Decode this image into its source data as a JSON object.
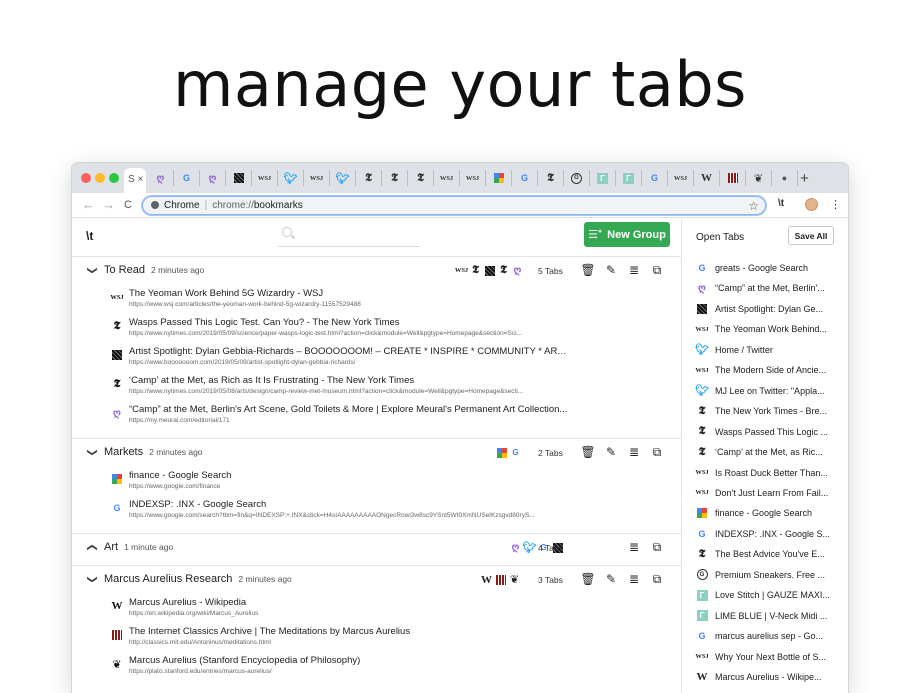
{
  "hero": {
    "title": "manage your tabs"
  },
  "browser": {
    "active_tab_label": "S ×",
    "tab_favicons": [
      "meural",
      "google",
      "meural",
      "booooooom",
      "wsj",
      "twitter",
      "wsj",
      "twitter",
      "nyt",
      "nyt",
      "nyt",
      "wsj",
      "wsj",
      "finance",
      "google",
      "nyt",
      "gauze",
      "stitch",
      "stitch",
      "google",
      "wsj",
      "wikipedia",
      "classics",
      "stanford",
      "apple"
    ],
    "new_tab": "+",
    "omnibar": {
      "back": "←",
      "forward": "→",
      "reload": "C",
      "site_label": "Chrome",
      "url_prefix": "chrome://",
      "url_path": "bookmarks",
      "star": "☆",
      "ext_label": "\\t",
      "menu": "⋮"
    }
  },
  "app": {
    "logo": "\\t",
    "search_placeholder": "",
    "new_group_label": "New Group",
    "groups": [
      {
        "name": "To Read",
        "time": "2 minutes ago",
        "expanded": true,
        "tab_count": "5 Tabs",
        "favicons": [
          "wsj",
          "nyt",
          "booooooom",
          "nyt",
          "meural"
        ],
        "items": [
          {
            "icon": "wsj",
            "title": "The Yeoman Work Behind 5G Wizardry - WSJ",
            "url": "https://www.wsj.com/articles/the-yeoman-work-behind-5g-wizardry-11557529488"
          },
          {
            "icon": "nyt",
            "title": "Wasps Passed This Logic Test. Can You? - The New York Times",
            "url": "https://www.nytimes.com/2019/05/09/science/paper-wasps-logic-test.html?action=click&module=Well&pgtype=Homepage&section=Sci..."
          },
          {
            "icon": "booooooom",
            "title": "Artist Spotlight: Dylan Gebbia-Richards – BOOOOOOOM! – CREATE * INSPIRE * COMMUNITY * ART * ...",
            "url": "https://www.booooooom.com/2019/05/09/artist-spotlight-dylan-gebbia-richards/"
          },
          {
            "icon": "nyt",
            "title": "‘Camp’ at the Met, as Rich as It Is Frustrating - The New York Times",
            "url": "https://www.nytimes.com/2019/05/08/arts/design/camp-review-met-museum.html?action=click&module=Well&pgtype=Homepage&secti..."
          },
          {
            "icon": "meural",
            "title": "“Camp” at the Met, Berlin's Art Scene, Gold Toilets & More | Explore Meural's Permanent Art Collection...",
            "url": "https://my.meural.com/editorial/171"
          }
        ]
      },
      {
        "name": "Markets",
        "time": "2 minutes ago",
        "expanded": true,
        "tab_count": "2 Tabs",
        "favicons": [
          "finance",
          "google"
        ],
        "items": [
          {
            "icon": "finance",
            "title": "finance - Google Search",
            "url": "https://www.google.com/finance"
          },
          {
            "icon": "google",
            "title": "INDEXSP: .INX - Google Search",
            "url": "https://www.google.com/search?tbm=fin&q=INDEXSP:+.INX&stick=H4sIAAAAAAAAAONgecRowi3w8sc9YSnt5Wt0XmNUSeIKzsgvd80ryS..."
          }
        ]
      },
      {
        "name": "Art",
        "time": "1 minute ago",
        "expanded": false,
        "tab_count": "4 Tabs",
        "favicons": [
          "meural",
          "twitter",
          "google",
          "booooooom"
        ],
        "items": []
      },
      {
        "name": "Marcus Aurelius Research",
        "time": "2 minutes ago",
        "expanded": true,
        "tab_count": "3 Tabs",
        "favicons": [
          "wikipedia",
          "classics",
          "stanford"
        ],
        "items": [
          {
            "icon": "wikipedia",
            "title": "Marcus Aurelius - Wikipedia",
            "url": "https://en.wikipedia.org/wiki/Marcus_Aurelius"
          },
          {
            "icon": "classics",
            "title": "The Internet Classics Archive | The Meditations by Marcus Aurelius",
            "url": "http://classics.mit.edu/Antoninus/meditations.html"
          },
          {
            "icon": "stanford",
            "title": "Marcus Aurelius (Stanford Encyclopedia of Philosophy)",
            "url": "https://plato.stanford.edu/entries/marcus-aurelius/"
          }
        ]
      }
    ]
  },
  "sidebar": {
    "title": "Open Tabs",
    "save_all_label": "Save All",
    "tabs": [
      {
        "icon": "google",
        "title": "greats - Google Search"
      },
      {
        "icon": "meural",
        "title": "“Camp” at the Met, Berlin'..."
      },
      {
        "icon": "booooooom",
        "title": "Artist Spotlight: Dylan Ge..."
      },
      {
        "icon": "wsj",
        "title": "The Yeoman Work Behind..."
      },
      {
        "icon": "twitter",
        "title": "Home / Twitter"
      },
      {
        "icon": "wsj",
        "title": "The Modern Side of Ancie..."
      },
      {
        "icon": "twitter",
        "title": "MJ Lee on Twitter: \"Appla..."
      },
      {
        "icon": "nyt",
        "title": "The New York Times - Bre..."
      },
      {
        "icon": "nyt",
        "title": "Wasps Passed This Logic ..."
      },
      {
        "icon": "nyt",
        "title": "‘Camp’ at the Met, as Ric..."
      },
      {
        "icon": "wsj",
        "title": "Is Roast Duck Better Than..."
      },
      {
        "icon": "wsj",
        "title": "Don't Just Learn From Fail..."
      },
      {
        "icon": "finance",
        "title": "finance - Google Search"
      },
      {
        "icon": "google",
        "title": "INDEXSP: .INX - Google S..."
      },
      {
        "icon": "nyt",
        "title": "The Best Advice You've E..."
      },
      {
        "icon": "gauze",
        "title": "Premium Sneakers. Free ..."
      },
      {
        "icon": "stitch",
        "title": "Love Stitch | GAUZE MAXI..."
      },
      {
        "icon": "stitch",
        "title": "LIME BLUE | V-Neck Midi ..."
      },
      {
        "icon": "google",
        "title": "marcus aurelius sep - Go..."
      },
      {
        "icon": "wsj",
        "title": "Why Your Next Bottle of S..."
      },
      {
        "icon": "wikipedia",
        "title": "Marcus Aurelius - Wikipe..."
      }
    ]
  },
  "colors": {
    "accent_green": "#34a853",
    "twitter_blue": "#1da1f2",
    "meural_purple": "#9b6fd6",
    "stitch_teal": "#8ecfc4"
  }
}
